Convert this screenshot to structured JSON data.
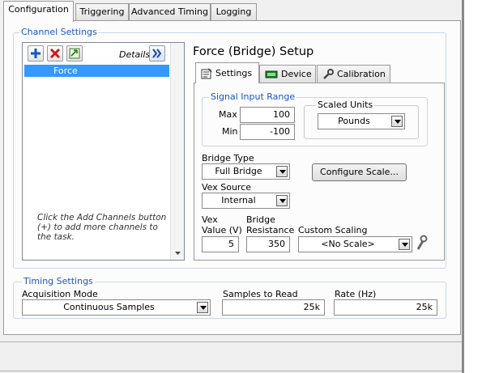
{
  "tabs": [
    "Configuration",
    "Triggering",
    "Advanced Timing",
    "Logging"
  ],
  "channel_settings": {
    "title": "Channel Settings",
    "details_label": "Details",
    "channels": [
      "Force"
    ],
    "hint": "Click the Add Channels button (+) to add more channels to the task."
  },
  "setup": {
    "title": "Force (Bridge) Setup",
    "tabs": [
      "Settings",
      "Device",
      "Calibration"
    ],
    "signal_input_range": {
      "title": "Signal Input Range",
      "max_label": "Max",
      "max_value": "100",
      "min_label": "Min",
      "min_value": "-100"
    },
    "scaled_units": {
      "title": "Scaled Units",
      "value": "Pounds"
    },
    "bridge_type": {
      "label": "Bridge Type",
      "value": "Full Bridge"
    },
    "configure_scale_label": "Configure Scale...",
    "vex_source": {
      "label": "Vex Source",
      "value": "Internal"
    },
    "vex_value": {
      "label_line1": "Vex",
      "label_line2": "Value (V)",
      "value": "5"
    },
    "bridge_resistance": {
      "label_line1": "Bridge",
      "label_line2": "Resistance",
      "value": "350"
    },
    "custom_scaling": {
      "label": "Custom Scaling",
      "value": "<No Scale>"
    }
  },
  "timing": {
    "title": "Timing Settings",
    "acquisition_mode": {
      "label": "Acquisition Mode",
      "value": "Continuous Samples"
    },
    "samples_to_read": {
      "label": "Samples to Read",
      "value": "25k"
    },
    "rate": {
      "label": "Rate (Hz)",
      "value": "25k"
    }
  },
  "colors": {
    "accent_title": "#1a55c8",
    "selection": "#3399ff"
  },
  "icons": [
    "add-icon",
    "delete-icon",
    "move-icon",
    "details-chevron-icon",
    "settings-icon",
    "device-icon",
    "calibration-icon",
    "scale-wrench-icon"
  ]
}
